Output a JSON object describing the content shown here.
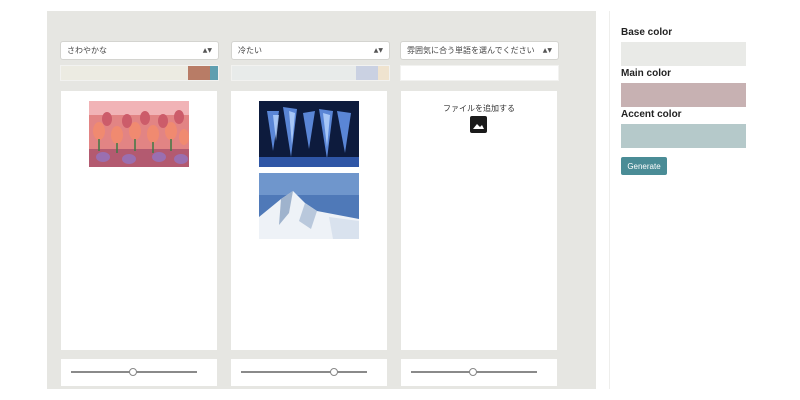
{
  "columns": [
    {
      "select_value": "さわやかな",
      "slider_value": 0.49,
      "swatches": [
        "#ecebe2",
        "#ecebe2",
        "#ecebe2",
        "#ecebe2",
        "#ecebe2",
        "#b87c66",
        "#5f9fb0"
      ],
      "weights": [
        0.2,
        0.2,
        0.2,
        0.2,
        0.03,
        0.15,
        0.05
      ]
    },
    {
      "select_value": "冷たい",
      "slider_value": 0.74,
      "swatches": [
        "#e8ebea",
        "#e8ebea",
        "#e8ebea",
        "#e8ebea",
        "#cad1e2",
        "#efe3cf"
      ],
      "weights": [
        0.25,
        0.25,
        0.25,
        0.04,
        0.14,
        0.07
      ]
    },
    {
      "select_value": "雰囲気に合う単語を選んでください",
      "slider_value": 0.49,
      "add_file_label": "ファイルを追加する"
    }
  ],
  "sidebar": {
    "base_label": "Base color",
    "base_color": "#e9eae7",
    "main_label": "Main color",
    "main_color": "#c7b1b2",
    "accent_label": "Accent color",
    "accent_color": "#b5c9ca",
    "generate_label": "Generate"
  }
}
